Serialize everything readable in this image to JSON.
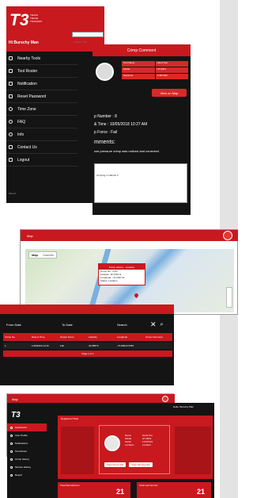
{
  "mobile": {
    "brand": "T3",
    "brand_sub": [
      "TRACK",
      "TRACE",
      "TRANSMIT"
    ],
    "greeting": "Hi Burschy Man",
    "search_placeholder": "Nearby Tool",
    "menu": [
      {
        "label": "Nearby Tools",
        "icon": "location-icon"
      },
      {
        "label": "Tool Roster",
        "icon": "list-icon"
      },
      {
        "label": "Notification",
        "icon": "bell-icon"
      },
      {
        "label": "Reset Password",
        "icon": "key-icon"
      },
      {
        "label": "Time Zone",
        "icon": "clock-icon"
      },
      {
        "label": "FAQ",
        "icon": "question-icon"
      },
      {
        "label": "Info",
        "icon": "info-icon"
      },
      {
        "label": "Contact Us",
        "icon": "mail-icon"
      },
      {
        "label": "Logout",
        "icon": "logout-icon"
      }
    ],
    "version": "V3.1.2"
  },
  "crimp": {
    "title": "Crimp Comment",
    "rows": [
      [
        "Tool Name",
        "Hand Tool"
      ],
      [
        "Model",
        "HT-0001"
      ],
      [
        "Serial No",
        "17007022"
      ]
    ],
    "view_on_map": "View on Map",
    "lines": [
      "p Number : 8",
      "& Time : 10/05/2018 10:27 AM",
      "p Force : Fail"
    ],
    "comments_label": "mments:",
    "comment_text": "use pressure crimp was noticed and corrected",
    "input_text": "crimping in cabinet 3"
  },
  "map": {
    "header": "Map",
    "tabs": [
      "Map",
      "Satellite"
    ],
    "popup_title": "Crimp History - Location",
    "popup_lines": [
      "Crimp No : 1721",
      "Latitude: 40.7361 N",
      "Longitude: -74.1597 W",
      "Status: Location"
    ],
    "footer": "Google"
  },
  "history": {
    "filters": [
      "From Date",
      "To Date",
      "Search"
    ],
    "columns": [
      "Crimp No.",
      "Date & Time",
      "Output Force",
      "Latitude",
      "Longitude",
      "Crimp Comment"
    ],
    "row": [
      "1",
      "1/18/2019 14:16",
      "Fail",
      "40.88570",
      "-73.80010 5780"
    ],
    "pager": "Page  1  of 1"
  },
  "map_small": {
    "header": "Map",
    "tabs": [
      "Map",
      "Satellite"
    ]
  },
  "dashboard": {
    "logo": "T3",
    "nav": [
      "Dashboard",
      "User Profile",
      "Notifications",
      "Tool Roster",
      "Crimp History",
      "Service History",
      "Report"
    ],
    "section": "Registered Tools",
    "tool_fields": [
      "Name",
      "Model",
      "Serial",
      "Location"
    ],
    "tool_values": [
      "Hand Tool",
      "HT-0001",
      "17007022",
      "Location"
    ],
    "btns": [
      "View Crimp Hist",
      "View Service Hist"
    ],
    "stat_labels": [
      "Total Manufacturer",
      "Total Last Service"
    ],
    "stat_values": [
      "21",
      "21"
    ],
    "top_right": "Hello, Burschy Man"
  },
  "colors": {
    "accent": "#c8191f",
    "dark": "#141414",
    "map_water": "#7ab0df"
  }
}
